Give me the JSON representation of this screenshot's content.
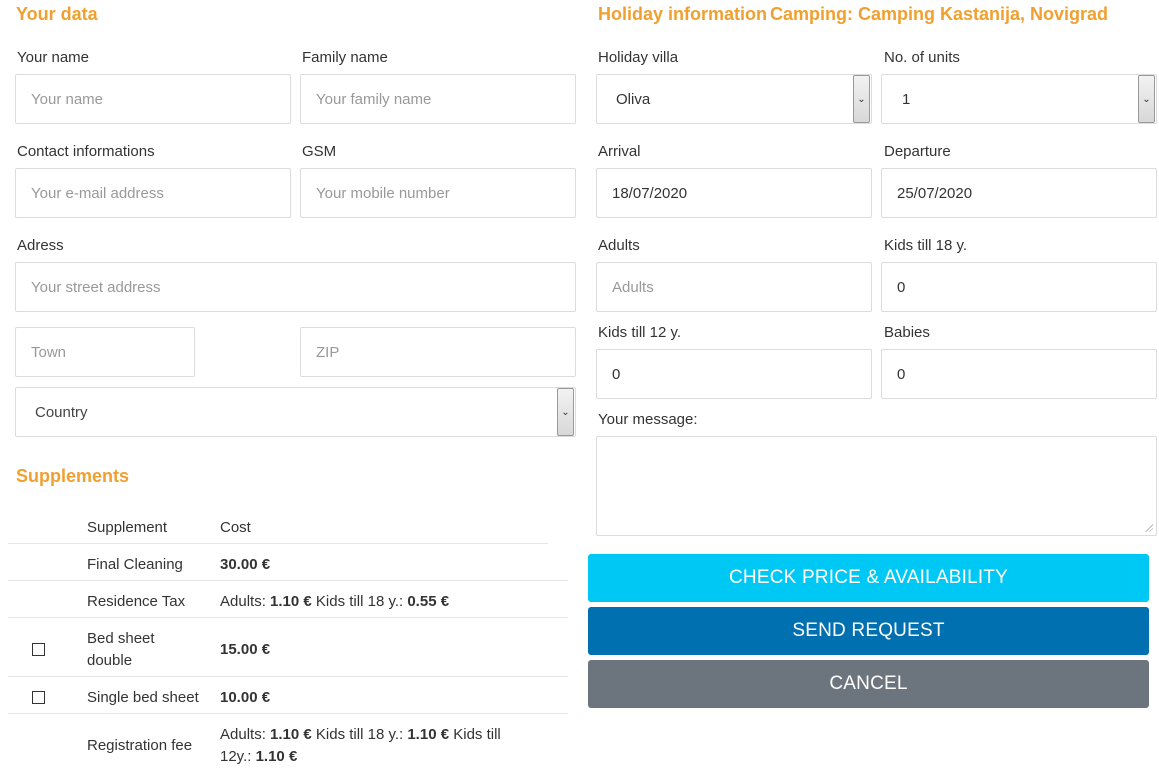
{
  "your_data": {
    "title": "Your data",
    "name_label": "Your name",
    "name_placeholder": "Your name",
    "family_label": "Family name",
    "family_placeholder": "Your family name",
    "contact_label": "Contact informations",
    "email_placeholder": "Your e-mail address",
    "gsm_label": "GSM",
    "gsm_placeholder": "Your mobile number",
    "address_label": "Adress",
    "address_placeholder": "Your street address",
    "town_placeholder": "Town",
    "zip_placeholder": "ZIP",
    "country_value": "Country"
  },
  "supplements": {
    "title": "Supplements",
    "header_supplement": "Supplement",
    "header_cost": "Cost",
    "rows": [
      {
        "name": "Final Cleaning",
        "cost": "30.00 €",
        "checkbox": false
      },
      {
        "name": "Residence Tax",
        "cost_parts": [
          "Adults: ",
          "1.10 €",
          " Kids till 18 y.: ",
          "0.55 €"
        ],
        "checkbox": false
      },
      {
        "name_lines": [
          "Bed sheet",
          "double"
        ],
        "cost": "15.00 €",
        "checkbox": true
      },
      {
        "name": "Single bed sheet",
        "cost": "10.00 €",
        "checkbox": true
      },
      {
        "name": "Registration fee",
        "cost_line1": [
          "Adults: ",
          "1.10 €",
          " Kids till 18 y.: ",
          "1.10 €",
          " Kids till"
        ],
        "cost_line2": [
          "12y.: ",
          "1.10 €"
        ],
        "checkbox": false
      }
    ]
  },
  "holiday": {
    "title": "Holiday information",
    "camping": "Camping: Camping Kastanija, Novigrad",
    "villa_label": "Holiday villa",
    "villa_value": "Oliva",
    "units_label": "No. of units",
    "units_value": "1",
    "arrival_label": "Arrival",
    "arrival_value": "18/07/2020",
    "departure_label": "Departure",
    "departure_value": "25/07/2020",
    "adults_label": "Adults",
    "adults_placeholder": "Adults",
    "kids18_label": "Kids till 18 y.",
    "kids18_value": "0",
    "kids12_label": "Kids till 12 y.",
    "kids12_value": "0",
    "babies_label": "Babies",
    "babies_value": "0",
    "message_label": "Your message:"
  },
  "buttons": {
    "check": "CHECK PRICE & AVAILABILITY",
    "send": "SEND REQUEST",
    "cancel": "CANCEL"
  },
  "colors": {
    "accent": "#f0a030",
    "check_btn": "#00c8f5",
    "send_btn": "#0070b0",
    "cancel_btn": "#6c757d"
  },
  "icons": {
    "select_arrow": "chevron-down-icon",
    "resize": "resize-handle-icon"
  }
}
